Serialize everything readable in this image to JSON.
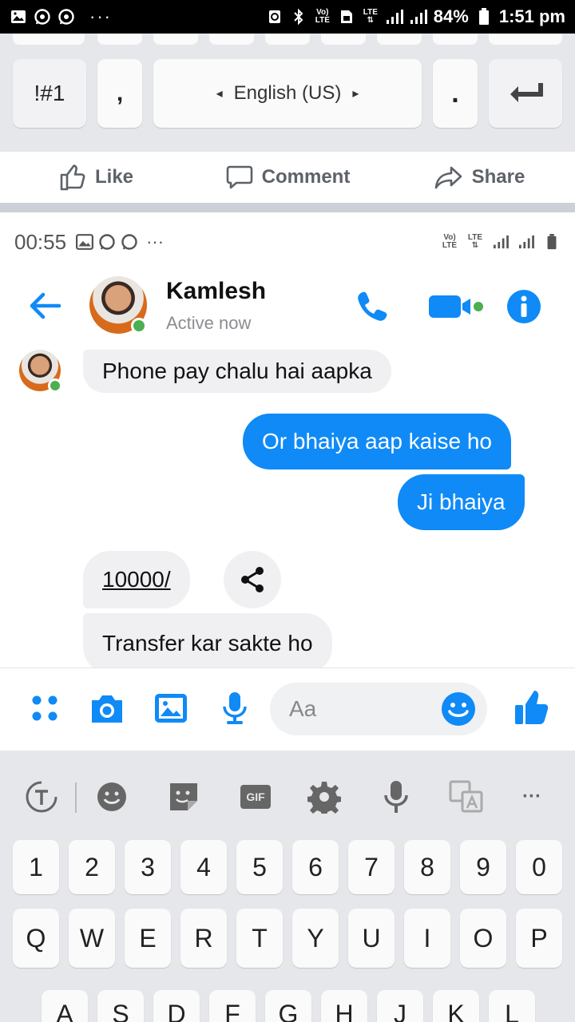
{
  "outer_status": {
    "battery": "84%",
    "time": "1:51 pm",
    "dots": "···"
  },
  "top_keyboard": {
    "symbols_key": "!#1",
    "comma_key": ",",
    "language": "English (US)",
    "period_key": ".",
    "lang_left": "◂",
    "lang_right": "▸"
  },
  "fb_actions": {
    "like": "Like",
    "comment": "Comment",
    "share": "Share"
  },
  "inner_status": {
    "time": "00:55",
    "dots": "···"
  },
  "chat_header": {
    "contact_name": "Kamlesh",
    "contact_status": "Active now"
  },
  "messages": [
    {
      "dir": "in",
      "text": "Phone pay chalu hai aapka"
    },
    {
      "dir": "out",
      "text": "Or bhaiya aap kaise ho"
    },
    {
      "dir": "out",
      "text": "Ji bhaiya"
    },
    {
      "dir": "in",
      "text": "10000/"
    },
    {
      "dir": "in",
      "text": "Transfer kar sakte ho"
    }
  ],
  "composer": {
    "placeholder": "Aa"
  },
  "keyboard": {
    "gif_label": "GIF",
    "tool_dots": "···",
    "numbers": [
      "1",
      "2",
      "3",
      "4",
      "5",
      "6",
      "7",
      "8",
      "9",
      "0"
    ],
    "letters_row1": [
      "Q",
      "W",
      "E",
      "R",
      "T",
      "Y",
      "U",
      "I",
      "O",
      "P"
    ],
    "letters_row2": [
      "A",
      "S",
      "D",
      "F",
      "G",
      "H",
      "J",
      "K",
      "L"
    ]
  },
  "colors": {
    "messenger_blue": "#0f8af7",
    "incoming_bubble": "#f0f0f2",
    "keyboard_bg": "#e6e7ea",
    "online_green": "#4caf50"
  },
  "icons": {
    "outer_status": [
      "image-icon",
      "whatsapp-icon",
      "whatsapp-icon",
      "recycle-icon",
      "bluetooth-icon",
      "volte-icon",
      "sim-icon",
      "lte-icon",
      "signal-icon",
      "signal-icon",
      "battery-icon"
    ],
    "composer": [
      "apps-grid-icon",
      "camera-icon",
      "gallery-icon",
      "microphone-icon",
      "emoji-icon",
      "thumbs-up-icon"
    ],
    "keyboard_tools": [
      "text-cursor-icon",
      "emoji-icon",
      "sticker-icon",
      "gif-icon",
      "settings-gear-icon",
      "microphone-icon",
      "translate-icon",
      "more-dots-icon"
    ]
  }
}
